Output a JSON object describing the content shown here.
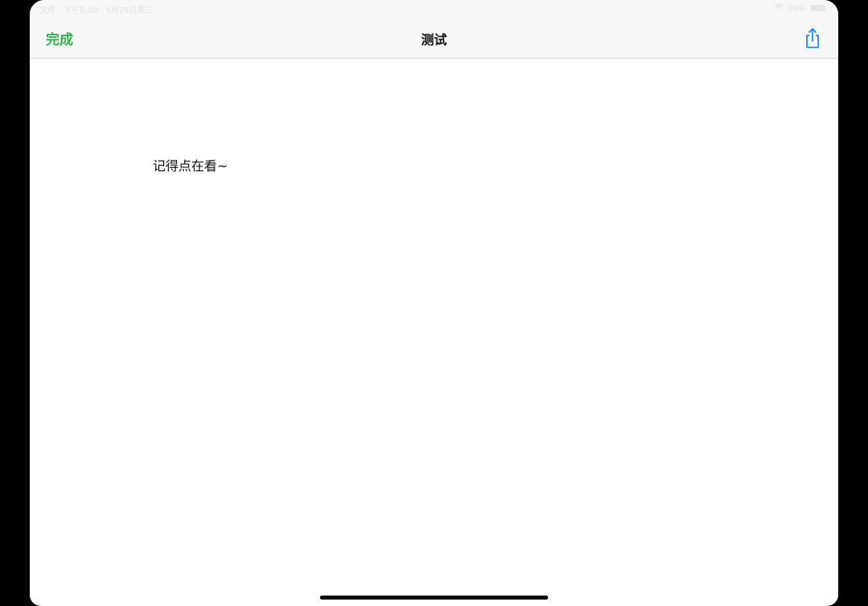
{
  "status_bar": {
    "app_back": "文件",
    "time": "下午5:00",
    "date": "9月29日周三",
    "battery_percent": "66%"
  },
  "nav": {
    "done_label": "完成",
    "title": "测试",
    "share_icon": "share-icon"
  },
  "document": {
    "text": "记得点在看~"
  },
  "colors": {
    "accent_green": "#2fb150",
    "share_blue": "#1a8cff"
  }
}
